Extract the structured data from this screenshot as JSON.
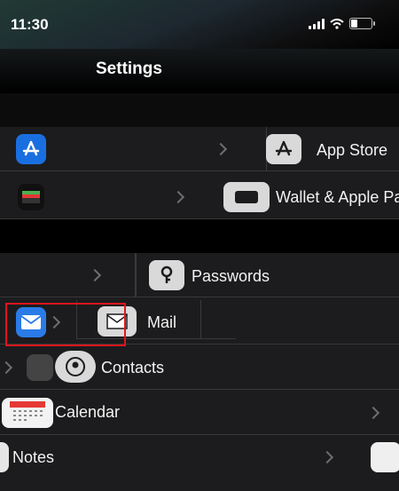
{
  "status_bar": {
    "time": "11:30"
  },
  "nav": {
    "title": "Settings"
  },
  "rows": [
    {
      "label": "App Store",
      "icon": "app-store-icon"
    },
    {
      "label": "Wallet & Apple Pa",
      "icon": "wallet-icon"
    },
    {
      "label": "Passwords",
      "icon": "key-icon"
    },
    {
      "label": "Mail",
      "icon": "mail-icon"
    },
    {
      "label": "Contacts",
      "icon": "contacts-icon"
    },
    {
      "label": "Calendar",
      "icon": "calendar-icon"
    },
    {
      "label": "Notes",
      "icon": "notes-icon"
    }
  ],
  "colors": {
    "app_store_blue": "#1a6fe0",
    "mail_blue": "#2a7be8",
    "highlight_red": "#e0141d",
    "separator": "#38383a"
  }
}
